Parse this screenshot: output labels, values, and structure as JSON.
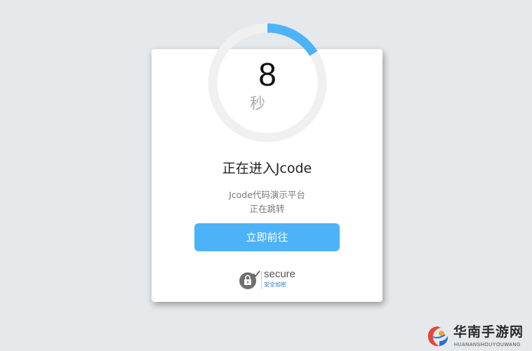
{
  "countdown": {
    "seconds": "8",
    "unit": "秒",
    "progress_fraction": 0.16,
    "colors": {
      "track": "#f1f0f0",
      "progress": "#4db3f8"
    }
  },
  "heading": "正在进入Jcode",
  "description": {
    "line1": "Jcode代码演示平台",
    "line2": "正在跳转"
  },
  "primary_button": {
    "label": "立即前往",
    "color": "#4db3f8"
  },
  "secure_badge": {
    "icon": "lock-icon",
    "title": "secure",
    "subtitle": "安全加密"
  },
  "watermark": {
    "icon": "huanan-logo-icon",
    "name": "华南手游网",
    "pinyin": "HUANANSHOUYOUWANG"
  }
}
